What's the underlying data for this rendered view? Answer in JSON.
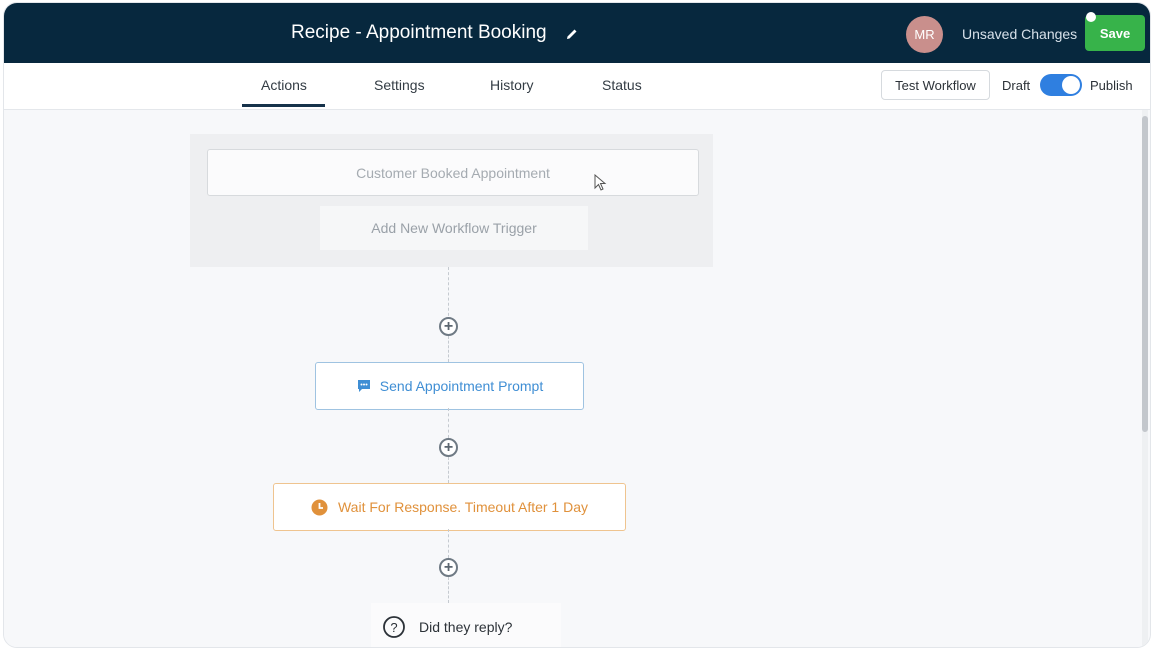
{
  "header": {
    "title": "Recipe - Appointment Booking",
    "avatar_initials": "MR",
    "unsaved_label": "Unsaved Changes",
    "save_label": "Save"
  },
  "tabs": [
    {
      "label": "Actions"
    },
    {
      "label": "Settings"
    },
    {
      "label": "History"
    },
    {
      "label": "Status"
    }
  ],
  "toolbar": {
    "test_workflow_label": "Test Workflow",
    "draft_label": "Draft",
    "publish_label": "Publish",
    "published": true
  },
  "workflow": {
    "trigger_label": "Customer Booked Appointment",
    "add_trigger_label": "Add New Workflow Trigger",
    "steps": [
      {
        "label": "Send Appointment Prompt",
        "icon": "chat-icon",
        "color": "#3f8ed4"
      },
      {
        "label": "Wait For Response. Timeout After 1 Day",
        "icon": "clock-icon",
        "color": "#e0913b"
      },
      {
        "label": "Did they reply?",
        "icon": "question-icon"
      }
    ]
  },
  "colors": {
    "header_bg": "#07283e",
    "save_green": "#37b34a",
    "toggle_blue": "#2f7fe0"
  }
}
